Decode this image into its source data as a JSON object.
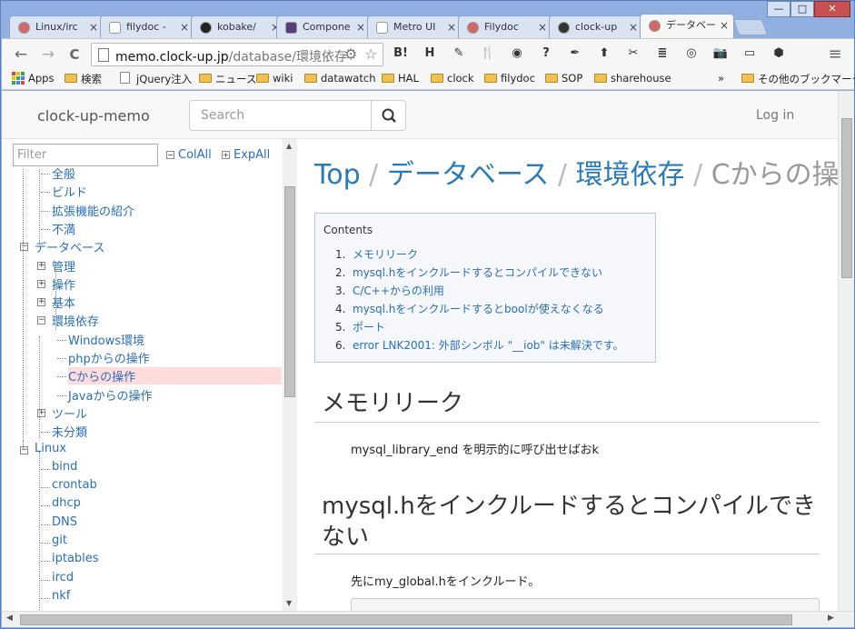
{
  "window": {
    "controls": {
      "minimize": "—",
      "maximize": "□",
      "close": "✕"
    }
  },
  "tabs": [
    {
      "label": "Linux/irc",
      "icon": "flower-icon",
      "color": "#d06a6a"
    },
    {
      "label": "filydoc -",
      "icon": "doc-icon",
      "color": "#ffffff"
    },
    {
      "label": "kobake/",
      "icon": "github-icon",
      "color": "#222222"
    },
    {
      "label": "Compone",
      "icon": "bootstrap-icon",
      "color": "#563d7c"
    },
    {
      "label": "Metro UI",
      "icon": "doc-icon",
      "color": "#ffffff"
    },
    {
      "label": "Filydoc",
      "icon": "flower-icon",
      "color": "#d06a6a"
    },
    {
      "label": "clock-up",
      "icon": "clock-icon",
      "color": "#333333"
    },
    {
      "label": "データベー",
      "icon": "flower-icon",
      "color": "#d06a6a"
    }
  ],
  "active_tab": 7,
  "toolbar": {
    "back": "←",
    "forward": "→",
    "reload": "C",
    "url_host": "memo.clock-up.jp",
    "url_path": "/database/環境依存",
    "menu": "≡"
  },
  "extensions": [
    "B!",
    "H",
    "✎",
    "🍴",
    "◉",
    "?",
    "✒",
    "⬆",
    "✂",
    "≣",
    "◎",
    "📷",
    "▭",
    "⬢"
  ],
  "bookmarks": [
    {
      "label": "Apps",
      "kind": "apps"
    },
    {
      "label": "検索",
      "kind": "folder"
    },
    {
      "label": "jQuery注入",
      "kind": "page"
    },
    {
      "label": "ニュース",
      "kind": "folder"
    },
    {
      "label": "wiki",
      "kind": "folder"
    },
    {
      "label": "datawatch",
      "kind": "folder"
    },
    {
      "label": "HAL",
      "kind": "folder"
    },
    {
      "label": "clock",
      "kind": "folder"
    },
    {
      "label": "filydoc",
      "kind": "folder"
    },
    {
      "label": "SOP",
      "kind": "folder"
    },
    {
      "label": "sharehouse",
      "kind": "folder"
    }
  ],
  "bookmarks_more": "»",
  "other_bookmarks": "その他のブックマーク",
  "header": {
    "brand": "clock-up-memo",
    "search_placeholder": "Search",
    "login": "Log in"
  },
  "sidebar": {
    "filter_placeholder": "Filter",
    "collapse_all": "ColAll",
    "expand_all": "ExpAll",
    "tree": [
      {
        "label": "全般",
        "level": 1,
        "toggle": ""
      },
      {
        "label": "ビルド",
        "level": 1,
        "toggle": ""
      },
      {
        "label": "拡張機能の紹介",
        "level": 1,
        "toggle": ""
      },
      {
        "label": "不満",
        "level": 1,
        "toggle": ""
      },
      {
        "label": "データベース",
        "level": 0,
        "toggle": "−"
      },
      {
        "label": "管理",
        "level": 1,
        "toggle": "+"
      },
      {
        "label": "操作",
        "level": 1,
        "toggle": "+"
      },
      {
        "label": "基本",
        "level": 1,
        "toggle": "+"
      },
      {
        "label": "環境依存",
        "level": 1,
        "toggle": "−"
      },
      {
        "label": "Windows環境",
        "level": 2,
        "toggle": ""
      },
      {
        "label": "phpからの操作",
        "level": 2,
        "toggle": ""
      },
      {
        "label": "Cからの操作",
        "level": 2,
        "toggle": "",
        "selected": true
      },
      {
        "label": "Javaからの操作",
        "level": 2,
        "toggle": ""
      },
      {
        "label": "ツール",
        "level": 1,
        "toggle": "+"
      },
      {
        "label": "未分類",
        "level": 1,
        "toggle": ""
      },
      {
        "label": "Linux",
        "level": 0,
        "toggle": "−"
      },
      {
        "label": "bind",
        "level": 1,
        "toggle": ""
      },
      {
        "label": "crontab",
        "level": 1,
        "toggle": ""
      },
      {
        "label": "dhcp",
        "level": 1,
        "toggle": ""
      },
      {
        "label": "DNS",
        "level": 1,
        "toggle": ""
      },
      {
        "label": "git",
        "level": 1,
        "toggle": ""
      },
      {
        "label": "iptables",
        "level": 1,
        "toggle": ""
      },
      {
        "label": "ircd",
        "level": 1,
        "toggle": ""
      },
      {
        "label": "nkf",
        "level": 1,
        "toggle": ""
      }
    ]
  },
  "main": {
    "breadcrumb": {
      "top": "Top",
      "database": "データベース",
      "env": "環境依存",
      "current": "Cからの操作",
      "separator": "/"
    },
    "toc": {
      "title": "Contents",
      "items": [
        {
          "num": "1.",
          "text": "メモリリーク"
        },
        {
          "num": "2.",
          "text": "mysql.hをインクルードするとコンパイルできない"
        },
        {
          "num": "3.",
          "text": "C/C++からの利用"
        },
        {
          "num": "4.",
          "text": "mysql.hをインクルードするとboolが使えなくなる"
        },
        {
          "num": "5.",
          "text": "ポート"
        },
        {
          "num": "6.",
          "text": "error LNK2001: 外部シンボル \"__iob\" は未解決です。"
        }
      ]
    },
    "section1_title": "メモリリーク",
    "section1_text": "mysql_library_end を明示的に呼び出せばおk",
    "section2_title_line1": "mysql.hをインクルードするとコンパイルでき",
    "section2_title_line2": "ない",
    "section2_text": "先にmy_global.hをインクルード。"
  }
}
